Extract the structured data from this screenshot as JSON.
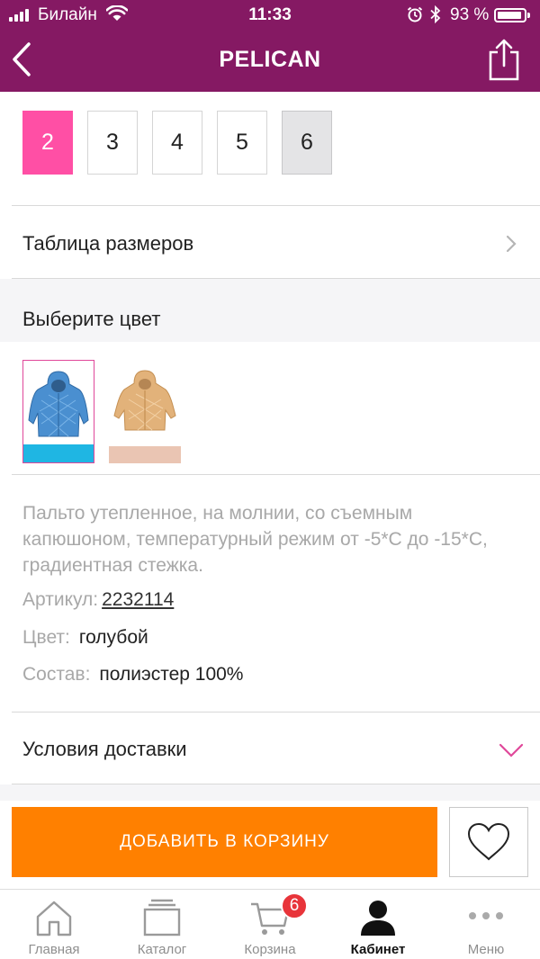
{
  "status_bar": {
    "carrier": "Билайн",
    "time": "11:33",
    "battery_percent": "93 %",
    "battery_level": 0.93
  },
  "header": {
    "title": "PELICAN",
    "background": "#851963"
  },
  "sizes": [
    {
      "label": "2",
      "state": "selected"
    },
    {
      "label": "3",
      "state": "available"
    },
    {
      "label": "4",
      "state": "available"
    },
    {
      "label": "5",
      "state": "available"
    },
    {
      "label": "6",
      "state": "unavailable"
    }
  ],
  "size_table_label": "Таблица размеров",
  "color_section_title": "Выберите цвет",
  "color_swatches": [
    {
      "name": "blue-jacket",
      "selected": true,
      "bar_color": "#1fb6e3",
      "jacket_color": "#4a8fd0"
    },
    {
      "name": "beige-jacket",
      "selected": false,
      "bar_color": "#eac5b3",
      "jacket_color": "#e2b27a"
    }
  ],
  "description": "Пальто утепленное, на молнии, со съемным капюшоном, температурный режим от -5*С до -15*С, градиентная стежка.",
  "details": {
    "article_label": "Артикул:",
    "article_value": "2232114",
    "color_label": "Цвет:",
    "color_value": "голубой",
    "composition_label": "Состав:",
    "composition_value": "полиэстер 100%"
  },
  "delivery_label": "Условия доставки",
  "add_to_cart_label": "ДОБАВИТЬ В КОРЗИНУ",
  "accent_colors": {
    "selected_size": "#ff4fa5",
    "add_button": "#ff8000",
    "badge": "#e8343a"
  },
  "tabs": [
    {
      "label": "Главная",
      "icon": "home-icon",
      "active": false
    },
    {
      "label": "Каталог",
      "icon": "catalog-icon",
      "active": false
    },
    {
      "label": "Корзина",
      "icon": "cart-icon",
      "active": false,
      "badge": "6"
    },
    {
      "label": "Кабинет",
      "icon": "profile-icon",
      "active": true
    },
    {
      "label": "Меню",
      "icon": "menu-dots-icon",
      "active": false
    }
  ]
}
